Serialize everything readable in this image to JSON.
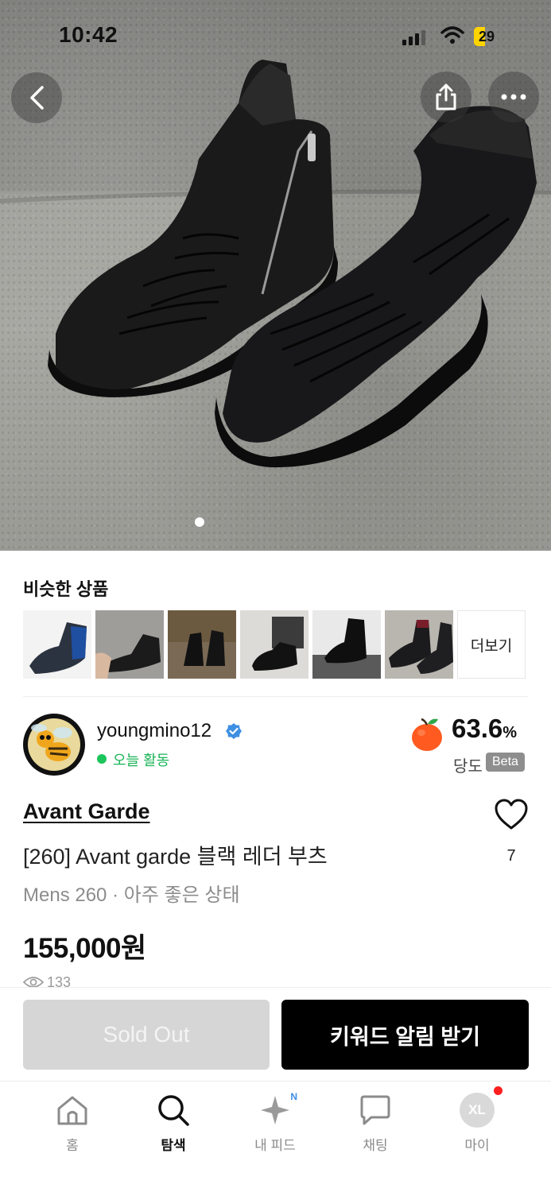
{
  "status_bar": {
    "time": "10:42",
    "battery": "29"
  },
  "similar": {
    "title": "비슷한 상품",
    "more_label": "더보기"
  },
  "seller": {
    "name": "youngmino12",
    "activity": "오늘 활동",
    "score": "63.6",
    "score_unit": "%",
    "score_label": "당도",
    "beta": "Beta"
  },
  "product": {
    "brand": "Avant Garde",
    "title": "[260] Avant garde 블랙 레더 부츠",
    "condition": "Mens  260 · 아주 좋은 상태",
    "price": "155,000원",
    "views": "133",
    "likes": "7"
  },
  "actions": {
    "sold_out": "Sold Out",
    "keyword_alert": "키워드 알림 받기"
  },
  "tabs": [
    {
      "label": "홈",
      "icon": "home-icon"
    },
    {
      "label": "탐색",
      "icon": "search-icon"
    },
    {
      "label": "내 피드",
      "icon": "sparkle-icon",
      "badge": "N"
    },
    {
      "label": "채팅",
      "icon": "chat-icon"
    },
    {
      "label": "마이",
      "icon": "avatar-icon",
      "avatar_text": "XL"
    }
  ],
  "colors": {
    "accent": "#000000",
    "online": "#1cc55b",
    "badge_blue": "#3a8ee6",
    "notify": "#ff1f1f"
  }
}
